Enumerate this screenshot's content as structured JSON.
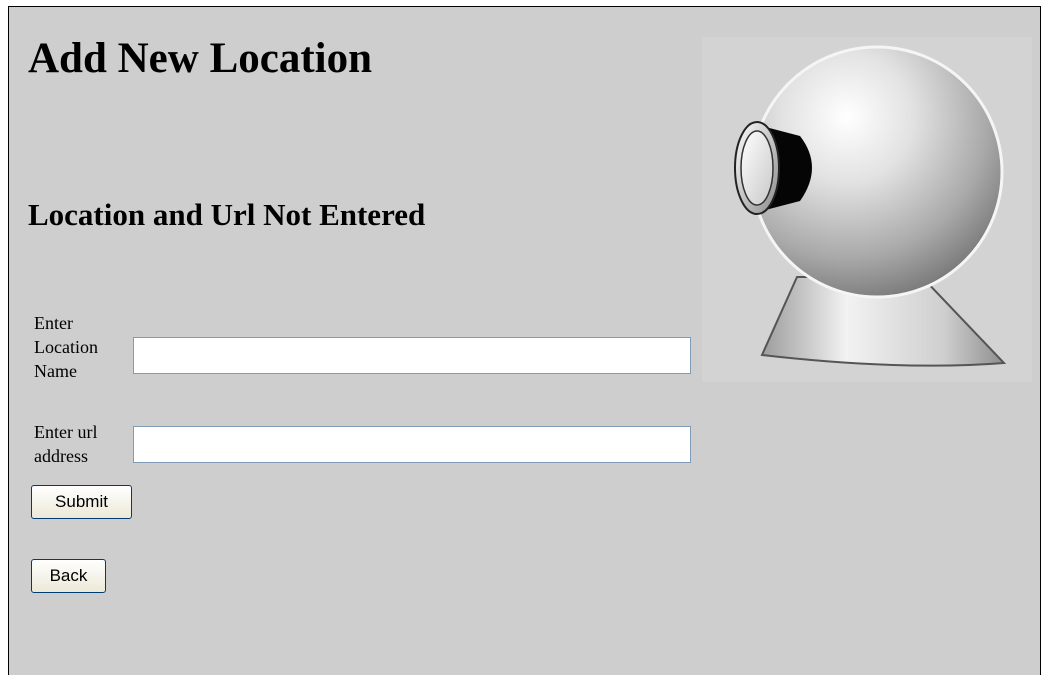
{
  "page": {
    "title": "Add New Location",
    "error_message": "Location and Url Not Entered"
  },
  "form": {
    "location_label": "Enter Location Name",
    "location_value": "",
    "url_label": "Enter url address",
    "url_value": "",
    "submit_label": "Submit"
  },
  "navigation": {
    "back_label": "Back"
  },
  "image": {
    "icon": "webcam-icon"
  }
}
